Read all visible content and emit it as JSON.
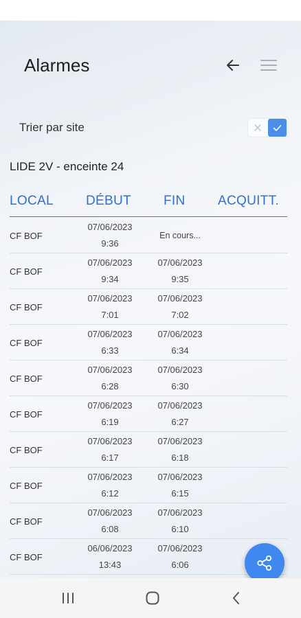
{
  "header": {
    "title": "Alarmes",
    "back_icon": "arrow-left-icon",
    "menu_icon": "hamburger-menu-icon"
  },
  "sort": {
    "label": "Trier par site",
    "toggle_off_icon": "close-icon",
    "toggle_on_icon": "check-icon",
    "enabled": true
  },
  "site": {
    "name": "LIDE 2V - enceinte 24"
  },
  "table": {
    "columns": [
      "LOCAL",
      "DÉBUT",
      "FIN",
      "ACQUITT."
    ],
    "rows": [
      {
        "local": "CF BOF",
        "debut_date": "07/06/2023",
        "debut_time": "9:36",
        "fin_date": "",
        "fin_time": "",
        "fin_text": "En cours..."
      },
      {
        "local": "CF BOF",
        "debut_date": "07/06/2023",
        "debut_time": "9:34",
        "fin_date": "07/06/2023",
        "fin_time": "9:35",
        "fin_text": ""
      },
      {
        "local": "CF BOF",
        "debut_date": "07/06/2023",
        "debut_time": "7:01",
        "fin_date": "07/06/2023",
        "fin_time": "7:02",
        "fin_text": ""
      },
      {
        "local": "CF BOF",
        "debut_date": "07/06/2023",
        "debut_time": "6:33",
        "fin_date": "07/06/2023",
        "fin_time": "6:34",
        "fin_text": ""
      },
      {
        "local": "CF BOF",
        "debut_date": "07/06/2023",
        "debut_time": "6:28",
        "fin_date": "07/06/2023",
        "fin_time": "6:30",
        "fin_text": ""
      },
      {
        "local": "CF BOF",
        "debut_date": "07/06/2023",
        "debut_time": "6:19",
        "fin_date": "07/06/2023",
        "fin_time": "6:27",
        "fin_text": ""
      },
      {
        "local": "CF BOF",
        "debut_date": "07/06/2023",
        "debut_time": "6:17",
        "fin_date": "07/06/2023",
        "fin_time": "6:18",
        "fin_text": ""
      },
      {
        "local": "CF BOF",
        "debut_date": "07/06/2023",
        "debut_time": "6:12",
        "fin_date": "07/06/2023",
        "fin_time": "6:15",
        "fin_text": ""
      },
      {
        "local": "CF BOF",
        "debut_date": "07/06/2023",
        "debut_time": "6:08",
        "fin_date": "07/06/2023",
        "fin_time": "6:10",
        "fin_text": ""
      },
      {
        "local": "CF BOF",
        "debut_date": "06/06/2023",
        "debut_time": "13:43",
        "fin_date": "07/06/2023",
        "fin_time": "6:06",
        "fin_text": ""
      }
    ]
  },
  "fab": {
    "icon": "share-icon"
  },
  "navbar": {
    "icons": [
      "recent-apps-icon",
      "home-icon",
      "back-icon"
    ]
  },
  "colors": {
    "accent": "#2f6fd3",
    "fab": "#3f88f0",
    "toggle_on": "#4b8ee8"
  }
}
